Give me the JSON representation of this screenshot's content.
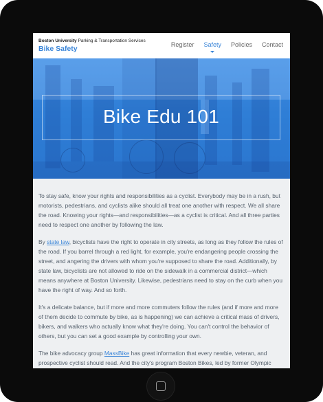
{
  "header": {
    "org_bold": "Boston University",
    "org_rest": "Parking & Transportation Services",
    "site_title": "Bike Safety"
  },
  "nav": {
    "items": [
      {
        "label": "Register"
      },
      {
        "label": "Safety",
        "active": true
      },
      {
        "label": "Policies"
      },
      {
        "label": "Contact"
      }
    ]
  },
  "hero": {
    "title": "Bike Edu 101"
  },
  "article": {
    "p1": "To stay safe, know your rights and responsibilities as a cyclist. Everybody may be in a rush, but motorists, pedestrians, and cyclists alike should all treat one another with respect. We all share the road. Knowing your rights—and responsibilities—as a cyclist is critical. And all three parties need to respect one another by following the law.",
    "p2_before": "By ",
    "p2_link": "state law",
    "p2_after": ", bicyclists have the right to operate in city streets, as long as they follow the rules of the road. If you barrel through a red light, for example, you're endangering people crossing the street, and angering the drivers with whom you're supposed to share the road. Additionally, by state law, bicyclists are not allowed to ride on the sidewalk in a commercial district—which means anywhere at Boston University. Likewise, pedestrians need to stay on the curb when you have the right of way. And so forth.",
    "p3": "It's a delicate balance, but if more and more commuters follow the rules (and if more and more of them decide to commute by bike, as is happening) we can achieve a critical mass of drivers, bikers, and walkers who actually know what they're doing. You can't control the behavior of others, but you can set a good example by controlling your own.",
    "p4_before": "The bike advocacy group ",
    "p4_link": "MassBike",
    "p4_after": " has great information that every newbie, veteran, and prospective cyclist should read. And the city's program Boston Bikes, led by former Olympic"
  },
  "colors": {
    "accent": "#3a85d8",
    "hero_blue": "#2f7ed6",
    "body_text": "#55606c",
    "device_frame": "#0b0b0b"
  },
  "icons": {
    "home_button": "home-square-icon"
  }
}
